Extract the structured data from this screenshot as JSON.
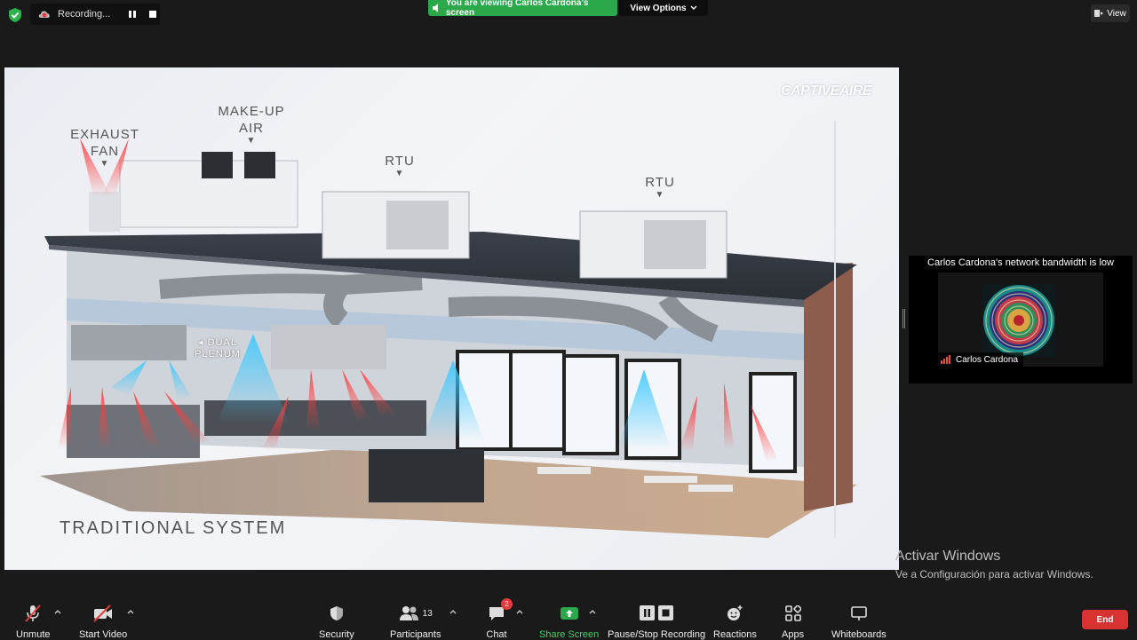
{
  "top": {
    "recording_label": "Recording...",
    "viewing_banner": "You are viewing Carlos Cardona's screen",
    "view_options": "View Options",
    "view_button": "View"
  },
  "shared_screen": {
    "brand": "CAPTIVEAIRE",
    "labels": {
      "exhaust_fan_1": "EXHAUST",
      "exhaust_fan_2": "FAN",
      "makeup_air_1": "MAKE-UP",
      "makeup_air_2": "AIR",
      "rtu_1": "RTU",
      "rtu_2": "RTU",
      "dual_plenum_1": "DUAL",
      "dual_plenum_2": "PLENUM"
    },
    "system_title": "TRADITIONAL SYSTEM"
  },
  "video_panel": {
    "bandwidth_notice": "Carlos Cardona's network bandwidth is low",
    "participant_name": "Carlos Cardona"
  },
  "os_watermark": {
    "line1": "Activar Windows",
    "line2": "Ve a Configuración para activar Windows."
  },
  "toolbar": {
    "unmute": "Unmute",
    "start_video": "Start Video",
    "security": "Security",
    "participants": "Participants",
    "participants_count": "13",
    "chat": "Chat",
    "chat_badge": "2",
    "share_screen": "Share Screen",
    "pause_stop_recording": "Pause/Stop Recording",
    "reactions": "Reactions",
    "apps": "Apps",
    "whiteboards": "Whiteboards",
    "end": "End"
  },
  "colors": {
    "share_green": "#2aa84a",
    "end_red": "#d83232",
    "badge_red": "#e23b3b"
  }
}
